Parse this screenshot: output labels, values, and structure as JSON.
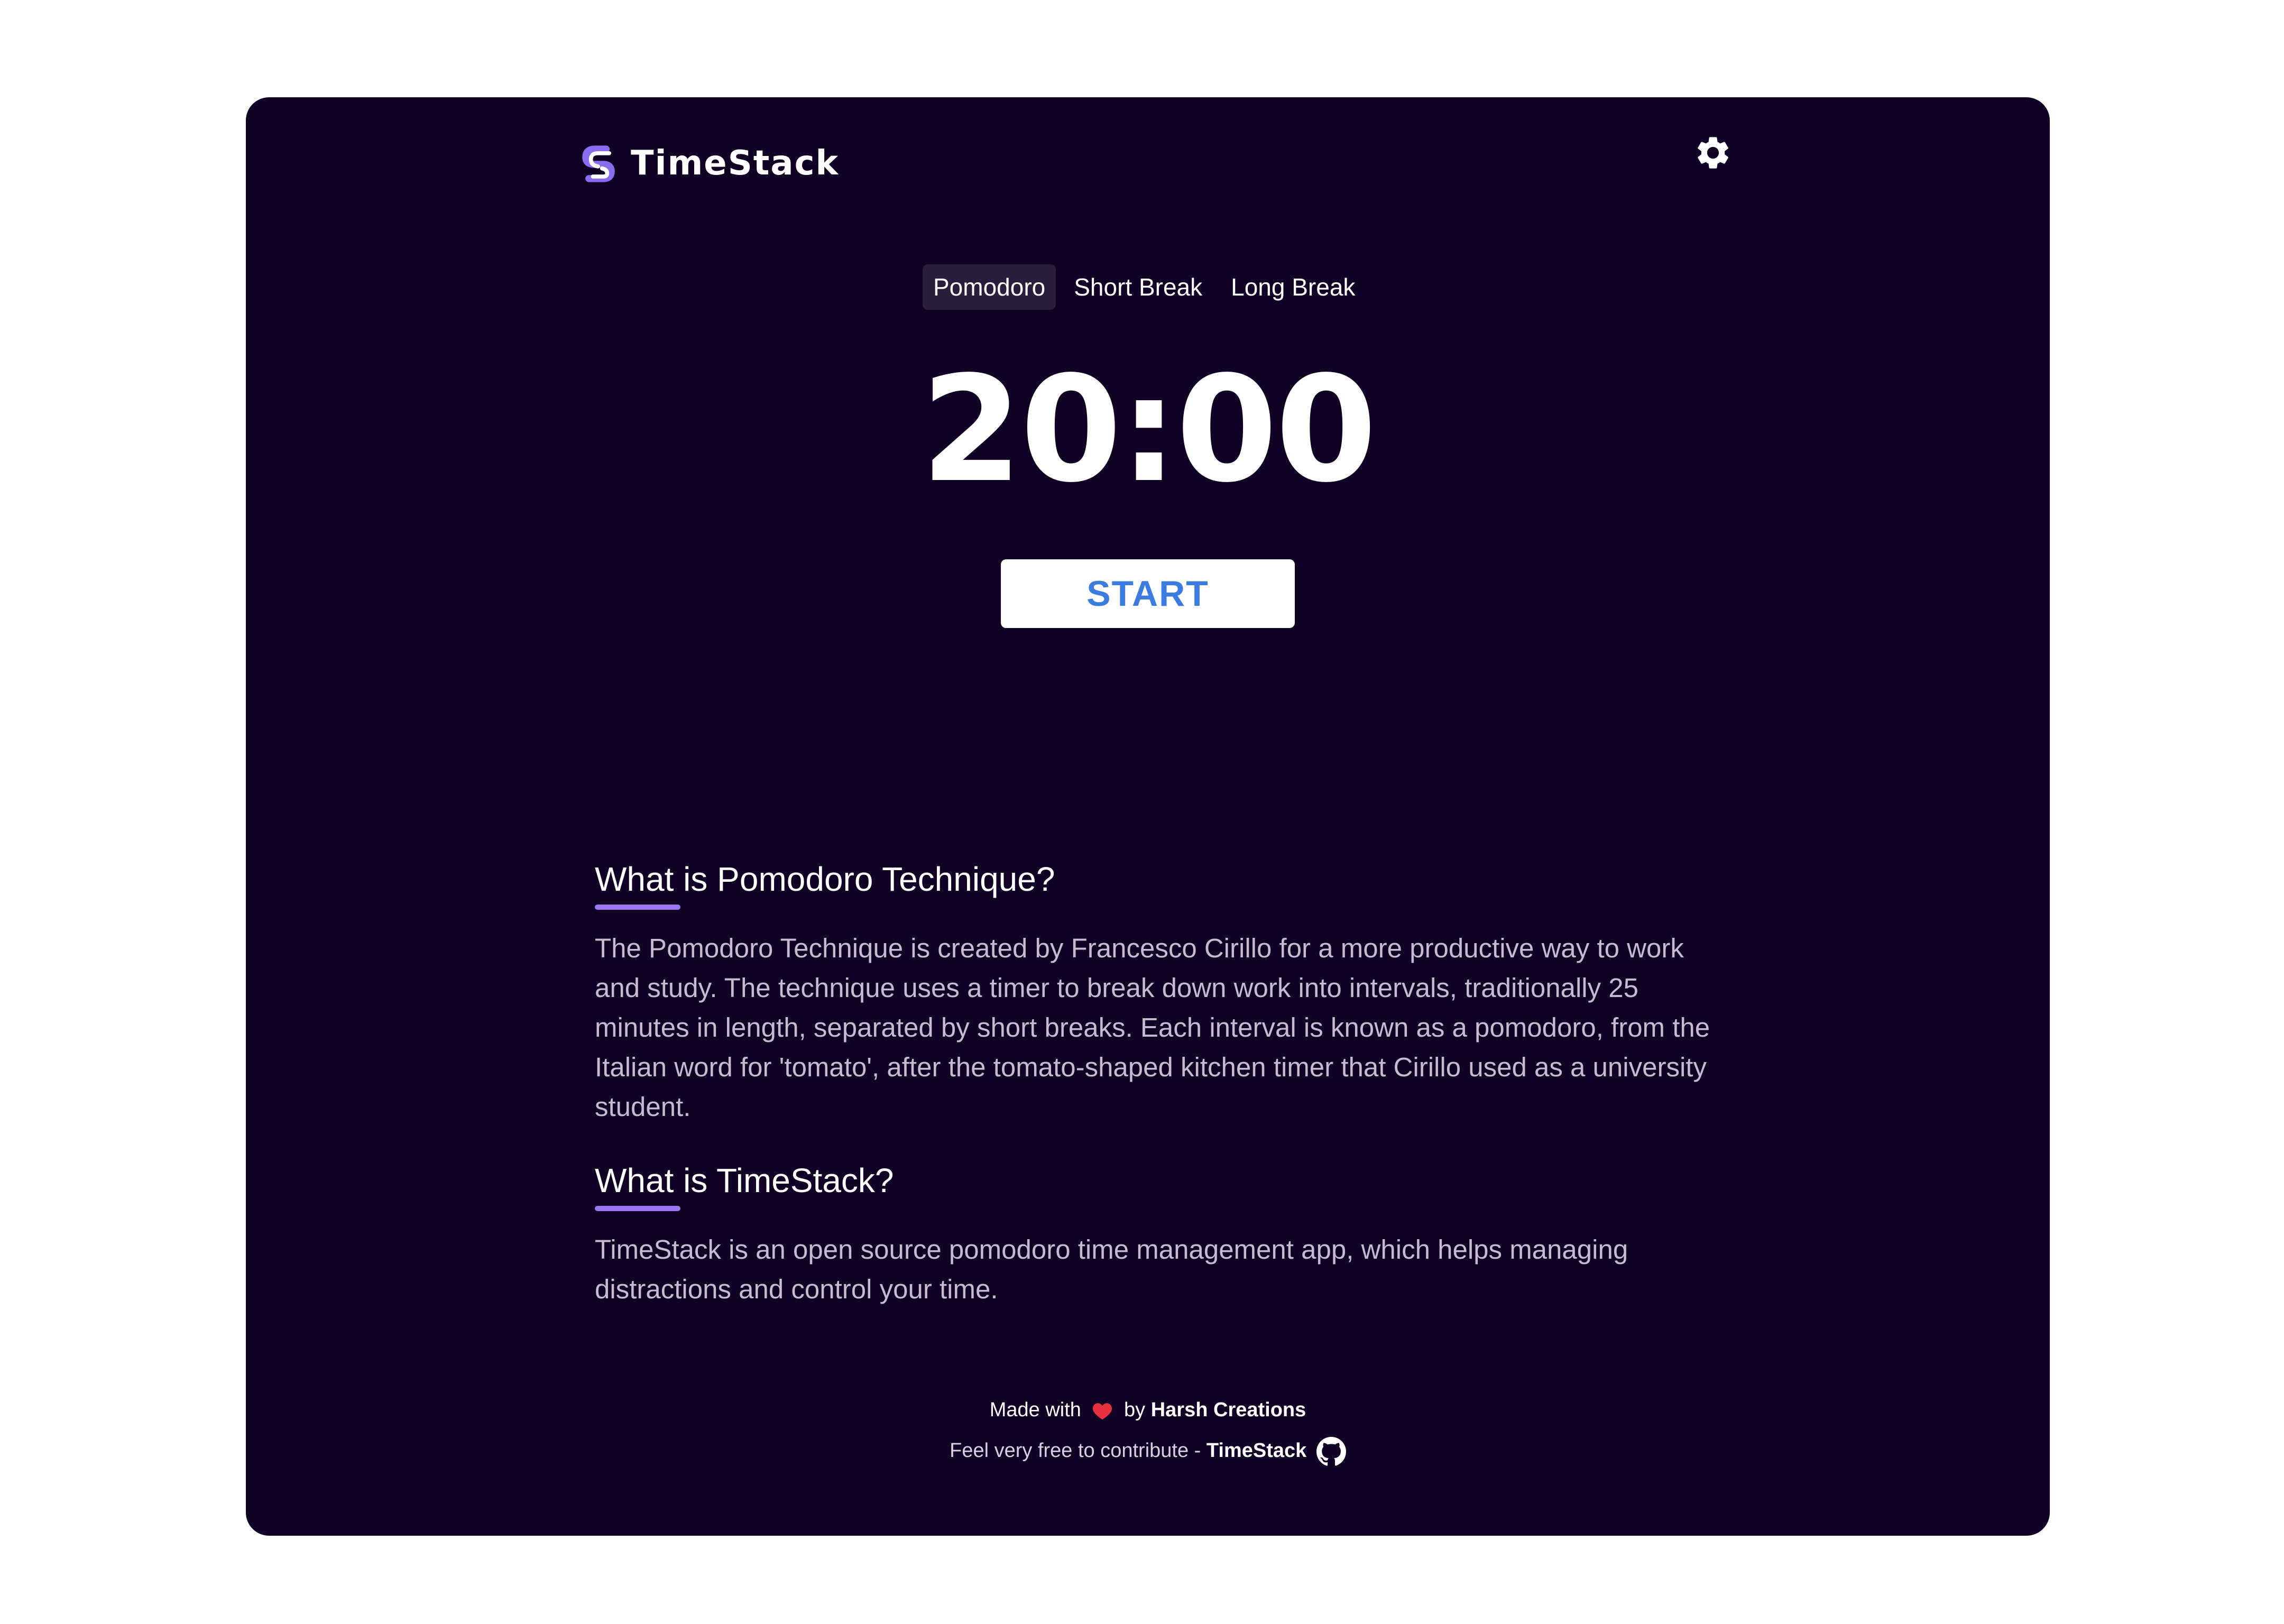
{
  "header": {
    "app_name": "TimeStack",
    "logo_icon": "timestack-logo-icon",
    "settings_icon": "gear-icon"
  },
  "tabs": [
    {
      "label": "Pomodoro",
      "active": true
    },
    {
      "label": "Short Break",
      "active": false
    },
    {
      "label": "Long Break",
      "active": false
    }
  ],
  "timer": {
    "display": "20:00",
    "start_label": "START"
  },
  "sections": [
    {
      "title": "What is Pomodoro Technique?",
      "body": "The Pomodoro Technique is created by Francesco Cirillo for a more productive way to work and study. The technique uses a timer to break down work into intervals, traditionally 25 minutes in length, separated by short breaks. Each interval is known as a pomodoro, from the Italian word for 'tomato', after the tomato-shaped kitchen timer that Cirillo used as a university student."
    },
    {
      "title": "What is TimeStack?",
      "body": "TimeStack is an open source pomodoro time management app, which helps managing distractions and control your time."
    }
  ],
  "footer": {
    "made_with": "Made with",
    "by": "by",
    "author": "Harsh Creations",
    "contribute_text": "Feel very free to contribute -",
    "repo_link": "TimeStack",
    "heart_icon": "heart-icon",
    "github_icon": "github-icon"
  },
  "colors": {
    "background": "#110124",
    "accent": "#9a76f2",
    "start_text": "#3c7ce0",
    "heart": "#e8303f"
  }
}
